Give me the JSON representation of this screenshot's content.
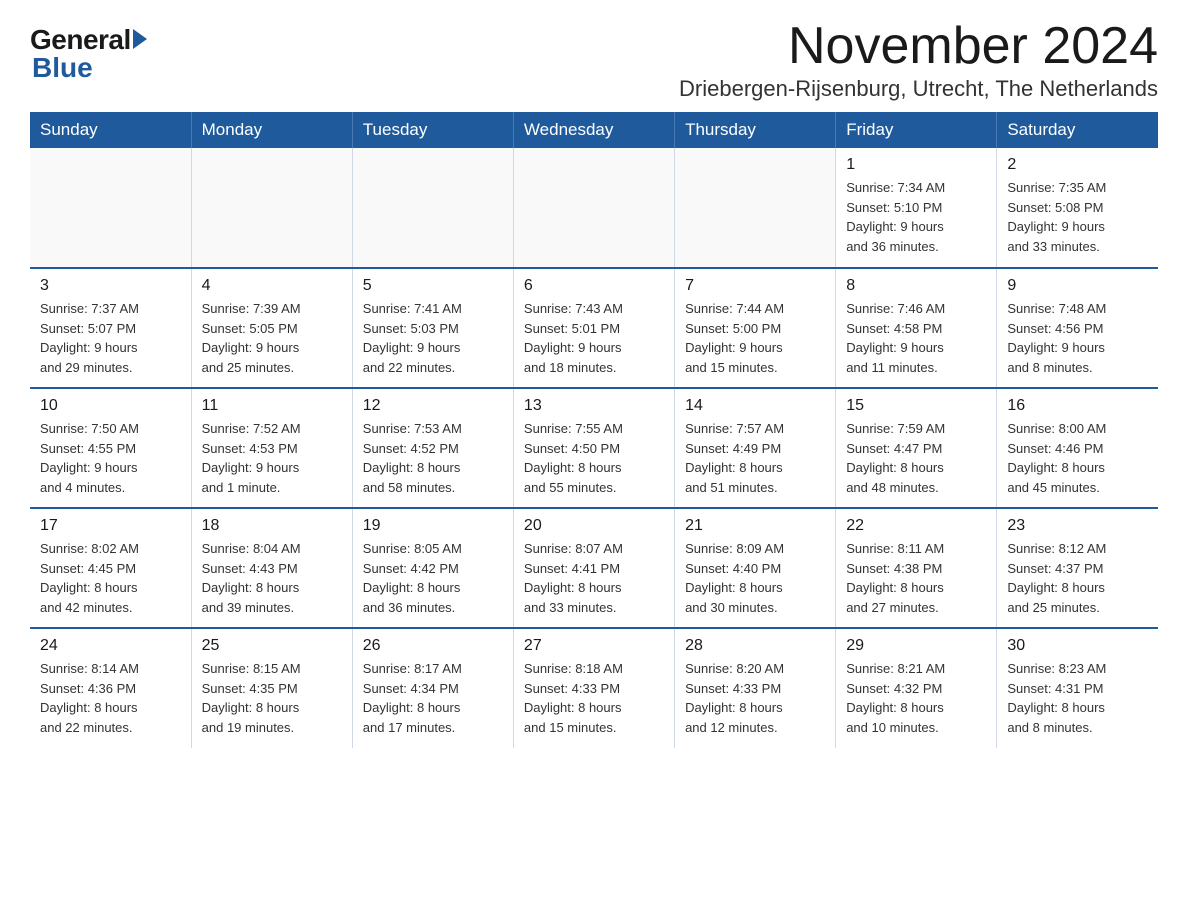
{
  "logo": {
    "general": "General",
    "blue": "Blue"
  },
  "title": {
    "month": "November 2024",
    "location": "Driebergen-Rijsenburg, Utrecht, The Netherlands"
  },
  "weekdays": [
    "Sunday",
    "Monday",
    "Tuesday",
    "Wednesday",
    "Thursday",
    "Friday",
    "Saturday"
  ],
  "weeks": [
    [
      {
        "day": "",
        "info": ""
      },
      {
        "day": "",
        "info": ""
      },
      {
        "day": "",
        "info": ""
      },
      {
        "day": "",
        "info": ""
      },
      {
        "day": "",
        "info": ""
      },
      {
        "day": "1",
        "info": "Sunrise: 7:34 AM\nSunset: 5:10 PM\nDaylight: 9 hours\nand 36 minutes."
      },
      {
        "day": "2",
        "info": "Sunrise: 7:35 AM\nSunset: 5:08 PM\nDaylight: 9 hours\nand 33 minutes."
      }
    ],
    [
      {
        "day": "3",
        "info": "Sunrise: 7:37 AM\nSunset: 5:07 PM\nDaylight: 9 hours\nand 29 minutes."
      },
      {
        "day": "4",
        "info": "Sunrise: 7:39 AM\nSunset: 5:05 PM\nDaylight: 9 hours\nand 25 minutes."
      },
      {
        "day": "5",
        "info": "Sunrise: 7:41 AM\nSunset: 5:03 PM\nDaylight: 9 hours\nand 22 minutes."
      },
      {
        "day": "6",
        "info": "Sunrise: 7:43 AM\nSunset: 5:01 PM\nDaylight: 9 hours\nand 18 minutes."
      },
      {
        "day": "7",
        "info": "Sunrise: 7:44 AM\nSunset: 5:00 PM\nDaylight: 9 hours\nand 15 minutes."
      },
      {
        "day": "8",
        "info": "Sunrise: 7:46 AM\nSunset: 4:58 PM\nDaylight: 9 hours\nand 11 minutes."
      },
      {
        "day": "9",
        "info": "Sunrise: 7:48 AM\nSunset: 4:56 PM\nDaylight: 9 hours\nand 8 minutes."
      }
    ],
    [
      {
        "day": "10",
        "info": "Sunrise: 7:50 AM\nSunset: 4:55 PM\nDaylight: 9 hours\nand 4 minutes."
      },
      {
        "day": "11",
        "info": "Sunrise: 7:52 AM\nSunset: 4:53 PM\nDaylight: 9 hours\nand 1 minute."
      },
      {
        "day": "12",
        "info": "Sunrise: 7:53 AM\nSunset: 4:52 PM\nDaylight: 8 hours\nand 58 minutes."
      },
      {
        "day": "13",
        "info": "Sunrise: 7:55 AM\nSunset: 4:50 PM\nDaylight: 8 hours\nand 55 minutes."
      },
      {
        "day": "14",
        "info": "Sunrise: 7:57 AM\nSunset: 4:49 PM\nDaylight: 8 hours\nand 51 minutes."
      },
      {
        "day": "15",
        "info": "Sunrise: 7:59 AM\nSunset: 4:47 PM\nDaylight: 8 hours\nand 48 minutes."
      },
      {
        "day": "16",
        "info": "Sunrise: 8:00 AM\nSunset: 4:46 PM\nDaylight: 8 hours\nand 45 minutes."
      }
    ],
    [
      {
        "day": "17",
        "info": "Sunrise: 8:02 AM\nSunset: 4:45 PM\nDaylight: 8 hours\nand 42 minutes."
      },
      {
        "day": "18",
        "info": "Sunrise: 8:04 AM\nSunset: 4:43 PM\nDaylight: 8 hours\nand 39 minutes."
      },
      {
        "day": "19",
        "info": "Sunrise: 8:05 AM\nSunset: 4:42 PM\nDaylight: 8 hours\nand 36 minutes."
      },
      {
        "day": "20",
        "info": "Sunrise: 8:07 AM\nSunset: 4:41 PM\nDaylight: 8 hours\nand 33 minutes."
      },
      {
        "day": "21",
        "info": "Sunrise: 8:09 AM\nSunset: 4:40 PM\nDaylight: 8 hours\nand 30 minutes."
      },
      {
        "day": "22",
        "info": "Sunrise: 8:11 AM\nSunset: 4:38 PM\nDaylight: 8 hours\nand 27 minutes."
      },
      {
        "day": "23",
        "info": "Sunrise: 8:12 AM\nSunset: 4:37 PM\nDaylight: 8 hours\nand 25 minutes."
      }
    ],
    [
      {
        "day": "24",
        "info": "Sunrise: 8:14 AM\nSunset: 4:36 PM\nDaylight: 8 hours\nand 22 minutes."
      },
      {
        "day": "25",
        "info": "Sunrise: 8:15 AM\nSunset: 4:35 PM\nDaylight: 8 hours\nand 19 minutes."
      },
      {
        "day": "26",
        "info": "Sunrise: 8:17 AM\nSunset: 4:34 PM\nDaylight: 8 hours\nand 17 minutes."
      },
      {
        "day": "27",
        "info": "Sunrise: 8:18 AM\nSunset: 4:33 PM\nDaylight: 8 hours\nand 15 minutes."
      },
      {
        "day": "28",
        "info": "Sunrise: 8:20 AM\nSunset: 4:33 PM\nDaylight: 8 hours\nand 12 minutes."
      },
      {
        "day": "29",
        "info": "Sunrise: 8:21 AM\nSunset: 4:32 PM\nDaylight: 8 hours\nand 10 minutes."
      },
      {
        "day": "30",
        "info": "Sunrise: 8:23 AM\nSunset: 4:31 PM\nDaylight: 8 hours\nand 8 minutes."
      }
    ]
  ]
}
